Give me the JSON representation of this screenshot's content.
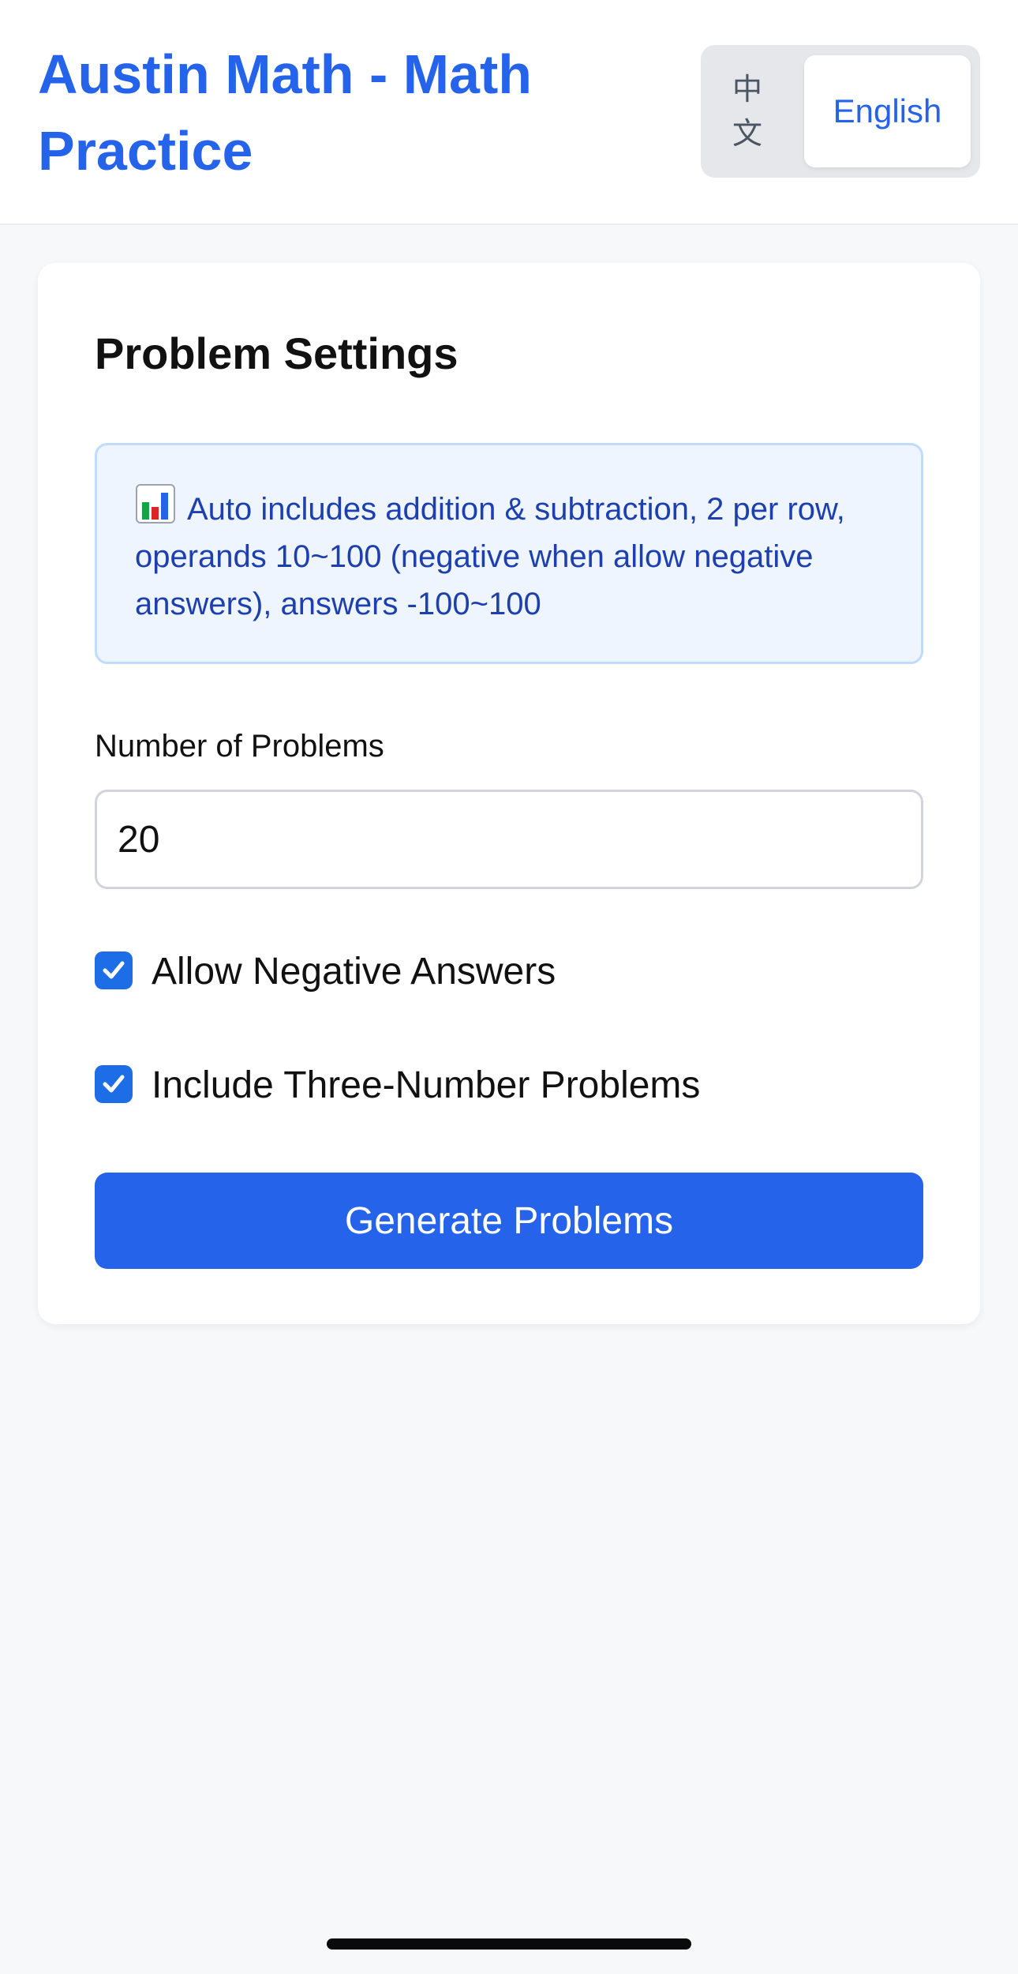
{
  "header": {
    "title": "Austin Math - Math Practice",
    "lang_zh": "中文",
    "lang_en": "English",
    "active_language": "English"
  },
  "settings": {
    "title": "Problem Settings",
    "info_icon": "bar-chart-emoji",
    "info_text": "Auto includes addition & subtraction, 2 per row, operands 10~100 (negative when allow negative answers), answers -100~100",
    "count_label": "Number of Problems",
    "count_value": "20",
    "allow_negative_label": "Allow Negative Answers",
    "allow_negative_checked": true,
    "three_number_label": "Include Three-Number Problems",
    "three_number_checked": true,
    "generate_label": "Generate Problems"
  },
  "colors": {
    "accent": "#2563eb",
    "info_bg": "#eef5fe",
    "info_text": "#1e40af",
    "checkbox": "#1d6ee6"
  }
}
